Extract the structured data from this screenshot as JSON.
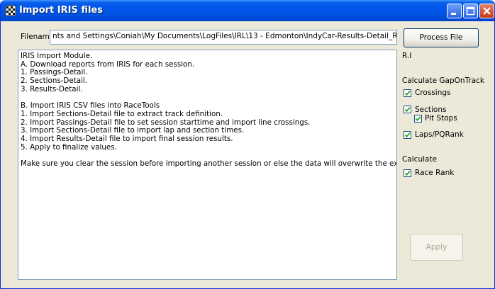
{
  "window": {
    "title": "Import IRIS files"
  },
  "filename": {
    "label": "Filename",
    "value": "nts and Settings\\Coniah\\My Documents\\LogFiles\\IRL\\13 - Edmonton\\IndyCar-Results-Detail_R.I.csv"
  },
  "info_text": {
    "lines": [
      "IRIS Import Module.",
      "A. Download reports from IRIS for each session.",
      "1. Passings-Detail.",
      "2. Sections-Detail.",
      "3. Results-Detail.",
      "",
      "B. Import IRIS CSV files into RaceTools",
      "1. Import Sections-Detail file to extract track definition.",
      "2. Import Passings-Detail file to set session starttime and import line crossings.",
      "3. Import Sections-Detail file to import lap and section times.",
      "4. Import Results-Detail file to import final session results.",
      "5. Apply to finalize values.",
      "",
      "Make sure you clear the session before importing another session or else the data will overwrite the existing s"
    ]
  },
  "panel": {
    "process_file_label": "Process File",
    "session_code": "R.I",
    "gap_heading": "Calculate GapOnTrack",
    "checkboxes": {
      "crossings": {
        "label": "Crossings",
        "checked": true
      },
      "sections": {
        "label": "Sections",
        "checked": true
      },
      "pit_stops": {
        "label": "Pit Stops",
        "checked": true
      },
      "laps_pqrank": {
        "label": "Laps/PQRank",
        "checked": true
      },
      "race_rank": {
        "label": "Race Rank",
        "checked": true
      }
    },
    "calculate_heading": "Calculate",
    "apply_label": "Apply"
  }
}
